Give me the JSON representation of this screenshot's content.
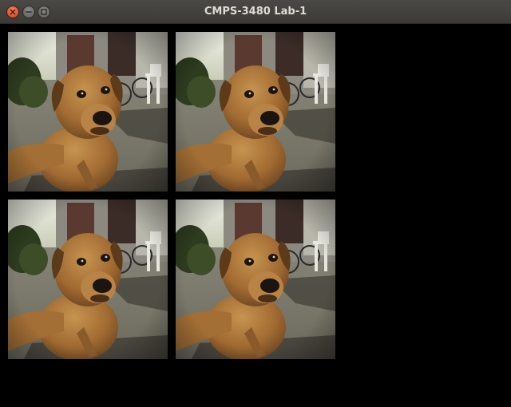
{
  "window": {
    "title": "CMPS-3480 Lab-1",
    "controls": {
      "close_icon": "close-icon",
      "minimize_icon": "minimize-icon",
      "maximize_icon": "maximize-icon"
    },
    "colors": {
      "titlebar": "#3f3e3b",
      "title_text": "#dfdbd2",
      "close": "#e5532b",
      "background": "#000000"
    }
  },
  "canvas": {
    "tiles": [
      {
        "subject": "dog-photo"
      },
      {
        "subject": "dog-photo"
      },
      {
        "subject": "dog-photo"
      },
      {
        "subject": "dog-photo"
      }
    ]
  }
}
